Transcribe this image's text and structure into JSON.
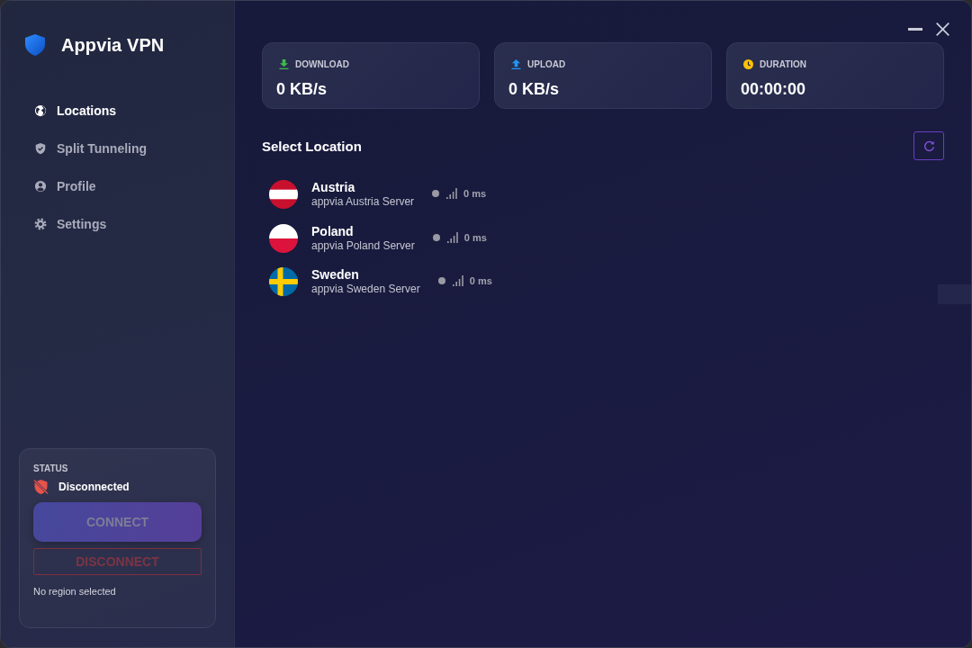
{
  "app": {
    "name": "Appvia VPN"
  },
  "nav": [
    {
      "label": "Locations",
      "kind": "globe",
      "selected": true
    },
    {
      "label": "Split Tunneling",
      "kind": "shield",
      "selected": false
    },
    {
      "label": "Profile",
      "kind": "user",
      "selected": false
    },
    {
      "label": "Settings",
      "kind": "gear",
      "selected": false
    }
  ],
  "status_panel": {
    "heading": "STATUS",
    "connected": false,
    "state_text": "Disconnected",
    "buttons": [
      {
        "label": "CONNECT",
        "kind": "primary",
        "disabled": true
      },
      {
        "label": "DISCONNECT",
        "kind": "outline",
        "disabled": true
      }
    ],
    "note": "No region selected"
  },
  "stats": [
    {
      "kind": "download",
      "label": "DOWNLOAD",
      "value": "0 KB/s"
    },
    {
      "kind": "upload",
      "label": "UPLOAD",
      "value": "0 KB/s"
    },
    {
      "kind": "duration",
      "label": "DURATION",
      "value": "00:00:00"
    }
  ],
  "locations": {
    "title": "Select Location",
    "items": [
      {
        "kind": "austria",
        "name": "Austria",
        "server": "appvia Austria Server",
        "latency": "0 ms",
        "selected": false
      },
      {
        "kind": "poland",
        "name": "Poland",
        "server": "appvia Poland Server",
        "latency": "0 ms",
        "selected": false
      },
      {
        "kind": "sweden",
        "name": "Sweden",
        "server": "appvia Sweden Server",
        "latency": "0 ms",
        "selected": false
      }
    ]
  }
}
